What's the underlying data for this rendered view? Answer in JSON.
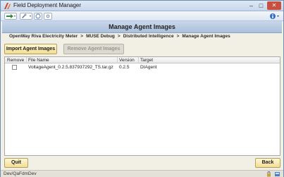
{
  "window": {
    "title": "Field Deployment Manager"
  },
  "header": {
    "title": "Manage Agent Images"
  },
  "breadcrumb": {
    "items": [
      "OpenWay Riva Electricity Meter",
      "MUSE Debug",
      "Distributed Intelligence",
      "Manage Agent Images"
    ],
    "separator": ">"
  },
  "actions": {
    "import_label": "Import Agent Images",
    "remove_label": "Remove Agent Images"
  },
  "table": {
    "columns": [
      "Remove",
      "File Name",
      "Version",
      "Target"
    ],
    "rows": [
      {
        "remove": false,
        "file_name": "VoltageAgent_0.2.5.837937292_TS.tar.gz",
        "version": "0.2.5",
        "target": "DIAgent"
      }
    ]
  },
  "footer": {
    "quit_label": "Quit",
    "back_label": "Back"
  },
  "status": {
    "text": "Dev/QaFdmDev"
  },
  "colors": {
    "accent": "#f1dd92",
    "header": "#aac0dc",
    "close": "#c7503f"
  }
}
